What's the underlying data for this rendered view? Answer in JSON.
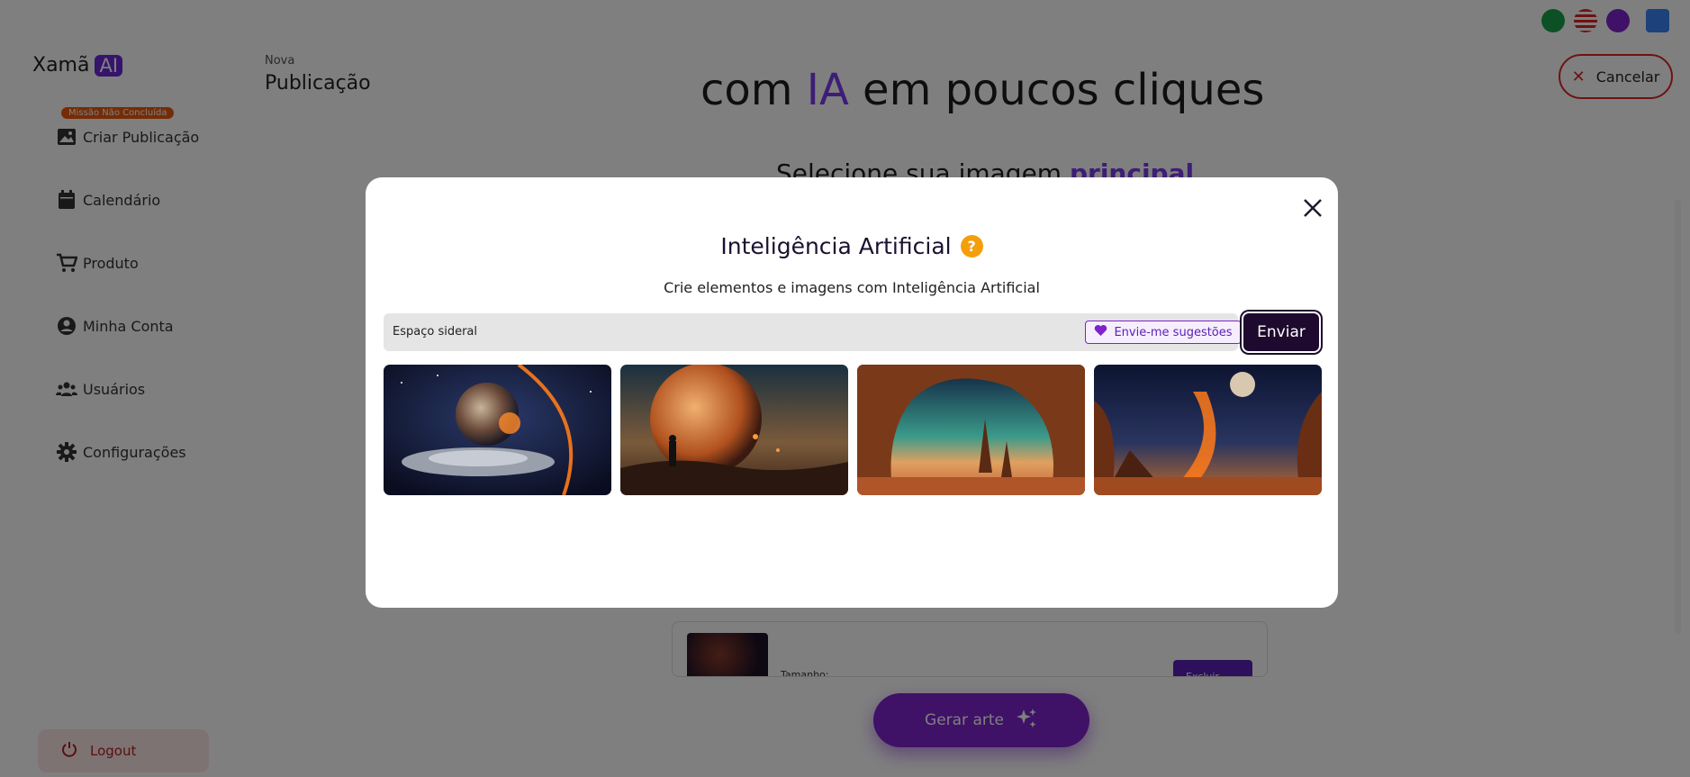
{
  "app": {
    "logo_text": "Xamã",
    "logo_badge": "AI"
  },
  "sidebar": {
    "mission_badge": "Missão Não Concluída",
    "items": [
      {
        "label": "Criar Publicação",
        "icon": "image-icon"
      },
      {
        "label": "Calendário",
        "icon": "calendar-icon"
      },
      {
        "label": "Produto",
        "icon": "cart-icon"
      },
      {
        "label": "Minha Conta",
        "icon": "user-circle-icon"
      },
      {
        "label": "Usuários",
        "icon": "users-icon"
      },
      {
        "label": "Configurações",
        "icon": "gear-icon"
      }
    ],
    "logout_label": "Logout"
  },
  "header": {
    "small_title": "Nova",
    "title": "Publicação",
    "cancel_label": "Cancelar"
  },
  "background": {
    "headline_start": "com ",
    "headline_ia": "IA",
    "headline_end": " em poucos cliques",
    "subtitle_start": "Selecione sua imagem ",
    "subtitle_bold": "principal",
    "card_size_label": "Tamanho:",
    "card_delete_label": "Excluir",
    "generate_label": "Gerar arte"
  },
  "modal": {
    "title": "Inteligência Artificial",
    "help_glyph": "?",
    "subtitle": "Crie elementos e imagens com Inteligência Artificial",
    "prompt_value": "Espaço sideral",
    "suggest_label": "Envie-me sugestões",
    "send_label": "Enviar",
    "images": [
      {
        "subject": "spaceship-planet"
      },
      {
        "subject": "astronaut-planet"
      },
      {
        "subject": "rock-arch-landscape"
      },
      {
        "subject": "volcanic-planet"
      }
    ]
  },
  "colors": {
    "accent": "#7e22ce",
    "danger": "#dc2626",
    "send": "#1e0a2e",
    "help": "#f59e0b"
  }
}
